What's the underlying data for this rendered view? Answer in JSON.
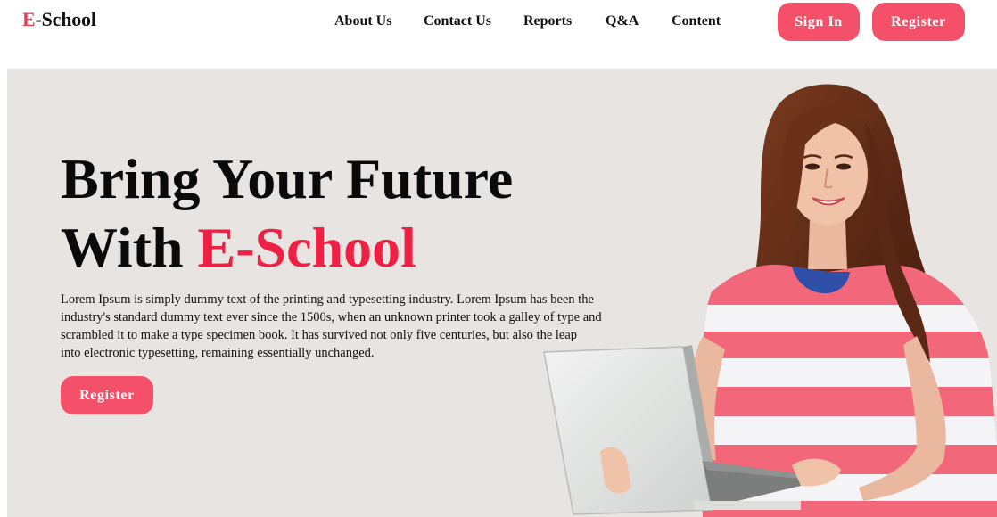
{
  "brand": {
    "logo_accent": "E",
    "logo_rest": "-School",
    "accent_color": "#ee3950",
    "button_color": "#f45069"
  },
  "nav": {
    "items": [
      "About Us",
      "Contact Us",
      "Reports",
      "Q&A",
      "Content"
    ]
  },
  "header_actions": {
    "sign_in": "Sign In",
    "register": "Register"
  },
  "hero": {
    "title_line1": "Bring Your Future",
    "title_line2_prefix": "With ",
    "title_line2_accent": "E-School",
    "description_lines": [
      "Lorem Ipsum is simply dummy text of the printing and typesetting industry. Lorem Ipsum has been the",
      "industry's standard dummy text ever since the 1500s, when an unknown printer took a galley of type and",
      "scrambled it to make a type specimen book. It has survived not only five centuries, but also the leap",
      "into electronic typesetting, remaining essentially unchanged."
    ],
    "cta": "Register",
    "background_color": "#e7e4e2"
  },
  "illustration": {
    "icon": "student-with-laptop-illustration"
  }
}
